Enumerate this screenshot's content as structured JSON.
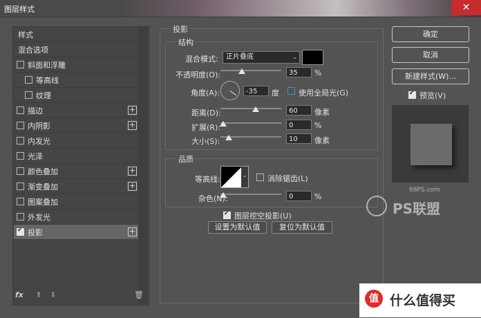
{
  "window": {
    "title": "图层样式",
    "close_glyph": "✕"
  },
  "left_list": {
    "header": "样式",
    "items": [
      {
        "label": "混合选项",
        "checkbox": false,
        "plus": false,
        "checked": false,
        "indent": 0
      },
      {
        "label": "斜面和浮雕",
        "checkbox": true,
        "plus": false,
        "checked": false,
        "indent": 0
      },
      {
        "label": "等高线",
        "checkbox": true,
        "plus": false,
        "checked": false,
        "indent": 1
      },
      {
        "label": "纹理",
        "checkbox": true,
        "plus": false,
        "checked": false,
        "indent": 1
      },
      {
        "label": "描边",
        "checkbox": true,
        "plus": true,
        "checked": false,
        "indent": 0
      },
      {
        "label": "内阴影",
        "checkbox": true,
        "plus": true,
        "checked": false,
        "indent": 0
      },
      {
        "label": "内发光",
        "checkbox": true,
        "plus": false,
        "checked": false,
        "indent": 0
      },
      {
        "label": "光泽",
        "checkbox": true,
        "plus": false,
        "checked": false,
        "indent": 0
      },
      {
        "label": "颜色叠加",
        "checkbox": true,
        "plus": true,
        "checked": false,
        "indent": 0
      },
      {
        "label": "渐变叠加",
        "checkbox": true,
        "plus": true,
        "checked": false,
        "indent": 0
      },
      {
        "label": "图案叠加",
        "checkbox": true,
        "plus": false,
        "checked": false,
        "indent": 0
      },
      {
        "label": "外发光",
        "checkbox": true,
        "plus": false,
        "checked": false,
        "indent": 0
      },
      {
        "label": "投影",
        "checkbox": true,
        "plus": true,
        "checked": true,
        "indent": 0,
        "selected": true
      }
    ],
    "fx_label": "fx"
  },
  "shadow": {
    "section_title": "投影",
    "structure_title": "结构",
    "blend_mode_label": "混合模式:",
    "blend_mode_value": "正片叠底",
    "color": "#000000",
    "opacity_label": "不透明度(O):",
    "opacity_value": "35",
    "opacity_unit": "%",
    "opacity_level": 0.35,
    "angle_label": "角度(A):",
    "angle_value": "-35",
    "angle_unit": "度",
    "global_light_label": "使用全局光(G)",
    "global_light_checked": false,
    "distance_label": "距离(D):",
    "distance_value": "60",
    "distance_unit": "像素",
    "spread_label": "扩展(R):",
    "spread_value": "0",
    "spread_unit": "%",
    "size_label": "大小(S):",
    "size_value": "10",
    "size_unit": "像素",
    "quality_title": "品质",
    "contour_label": "等高线:",
    "antialias_label": "消除锯齿(L)",
    "antialias_checked": false,
    "noise_label": "杂色(N):",
    "noise_value": "0",
    "noise_unit": "%",
    "knockout_label": "图层挖空投影(U)",
    "knockout_checked": true,
    "set_default_label": "设置为默认值",
    "reset_default_label": "复位为默认值"
  },
  "right": {
    "ok_label": "确定",
    "cancel_label": "取消",
    "new_style_label": "新建样式(W)...",
    "preview_label": "预览(V)",
    "preview_checked": true
  },
  "watermark": {
    "site": "68PS.com",
    "brand": "PS联盟"
  },
  "footer": {
    "text": "值 什么值得买",
    "icon_glyph": "值"
  }
}
